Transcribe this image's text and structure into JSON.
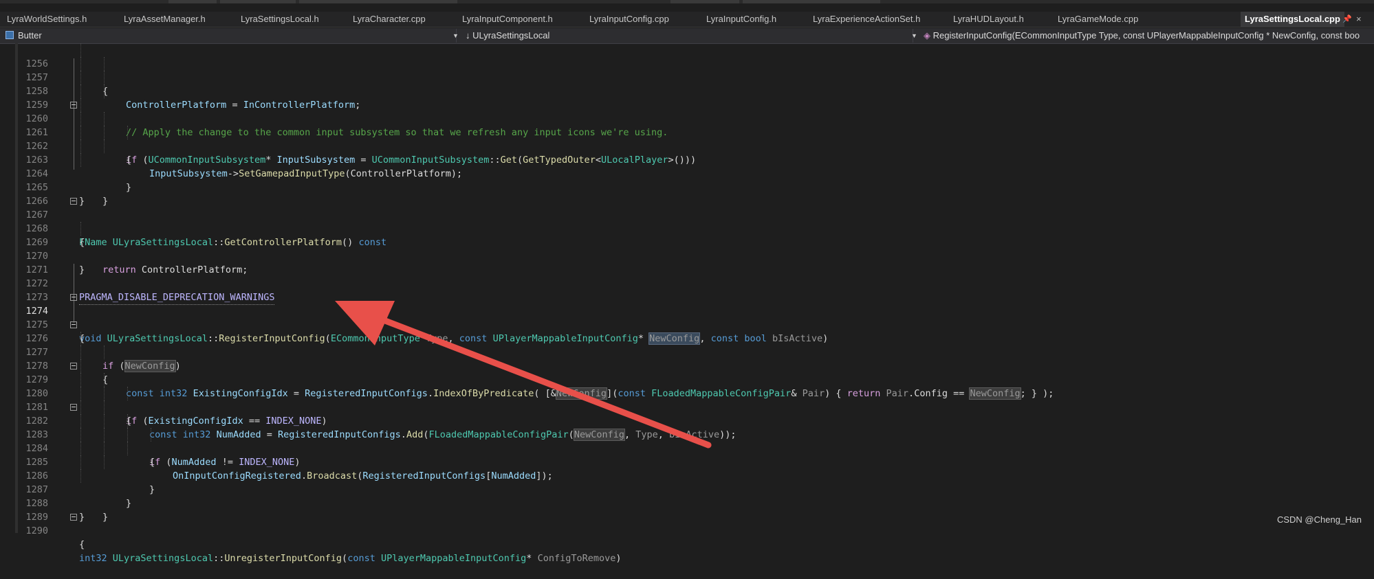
{
  "tabs": [
    "LyraWorldSettings.h",
    "LyraAssetManager.h",
    "LyraSettingsLocal.h",
    "LyraCharacter.cpp",
    "LyraInputComponent.h",
    "LyraInputConfig.cpp",
    "LyraInputConfig.h",
    "LyraExperienceActionSet.h",
    "LyraHUDLayout.h",
    "LyraGameMode.cpp",
    "LyraSettingsLocal.cpp"
  ],
  "active_tab": "LyraSettingsLocal.cpp",
  "nav": {
    "project": "Butter",
    "scope": "ULyraSettingsLocal",
    "member": "RegisterInputConfig(ECommonInputType Type, const UPlayerMappableInputConfig * NewConfig, const boo"
  },
  "line_numbers": [
    "1256",
    "1257",
    "1258",
    "1259",
    "1260",
    "1261",
    "1262",
    "1263",
    "1264",
    "1265",
    "1266",
    "1267",
    "1268",
    "1269",
    "1270",
    "1271",
    "1272",
    "1273",
    "1274",
    "1275",
    "1276",
    "1277",
    "1278",
    "1279",
    "1280",
    "1281",
    "1282",
    "1283",
    "1284",
    "1285",
    "1286",
    "1287",
    "1288",
    "1289",
    "1290"
  ],
  "current_line": "1274",
  "code": {
    "l1257": [
      "ControllerPlatform",
      " = ",
      "InControllerPlatform",
      ";"
    ],
    "l1259": "// Apply the change to the common input subsystem so that we refresh any input icons we're using.",
    "l1260": [
      "if",
      " (",
      "UCommonInputSubsystem",
      "* ",
      "InputSubsystem",
      " = ",
      "UCommonInputSubsystem",
      "::",
      "Get",
      "(",
      "GetTypedOuter",
      "<",
      "ULocalPlayer",
      ">()))"
    ],
    "l1262": [
      "InputSubsystem",
      "->",
      "SetGamepadInputType",
      "(ControllerPlatform);"
    ],
    "l1267": [
      "FName",
      " ",
      "ULyraSettingsLocal",
      "::",
      "GetControllerPlatform",
      "() ",
      "const"
    ],
    "l1269": [
      "return",
      " ControllerPlatform;"
    ],
    "l1272": "PRAGMA_DISABLE_DEPRECATION_WARNINGS",
    "l1274": [
      "void",
      " ",
      "ULyraSettingsLocal",
      "::",
      "RegisterInputConfig",
      "(",
      "ECommonInputType",
      " ",
      "Type",
      ", ",
      "const",
      " ",
      "UPlayerMappableInputConfig",
      "* ",
      "NewConfig",
      ", ",
      "const",
      " ",
      "bool",
      " ",
      "bIsActive",
      ")"
    ],
    "l1276": [
      "if",
      " (",
      "NewConfig",
      ")"
    ],
    "l1278": [
      "const",
      " ",
      "int32",
      " ",
      "ExistingConfigIdx",
      " = ",
      "RegisteredInputConfigs",
      ".",
      "IndexOfByPredicate",
      "( [&",
      "NewConfig",
      "](",
      "const",
      " ",
      "FLoadedMappableConfigPair",
      "& ",
      "Pair",
      ") { ",
      "return",
      " ",
      "Pair",
      ".",
      "Config",
      " == ",
      "NewConfig",
      "; } );"
    ],
    "l1279": [
      "if",
      " (",
      "ExistingConfigIdx",
      " == ",
      "INDEX_NONE",
      ")"
    ],
    "l1281": [
      "const",
      " ",
      "int32",
      " ",
      "NumAdded",
      " = ",
      "RegisteredInputConfigs",
      ".",
      "Add",
      "(",
      "FLoadedMappableConfigPair",
      "(",
      "NewConfig",
      ", ",
      "Type",
      ", ",
      "bIsActive",
      "));"
    ],
    "l1282": [
      "if",
      " (",
      "NumAdded",
      " != ",
      "INDEX_NONE",
      ")"
    ],
    "l1284": [
      "OnInputConfigRegistered",
      ".",
      "Broadcast",
      "(",
      "RegisteredInputConfigs",
      "[",
      "NumAdded",
      "]);"
    ],
    "l1290": [
      "int32",
      " ",
      "ULyraSettingsLocal",
      "::",
      "UnregisterInputConfig",
      "(",
      "const",
      " ",
      "UPlayerMappableInputConfig",
      "* ",
      "ConfigToRemove",
      ")"
    ]
  },
  "watermark": "CSDN @Cheng_Han",
  "annotation": {
    "kind": "red-arrow",
    "color": "#e8504a"
  }
}
